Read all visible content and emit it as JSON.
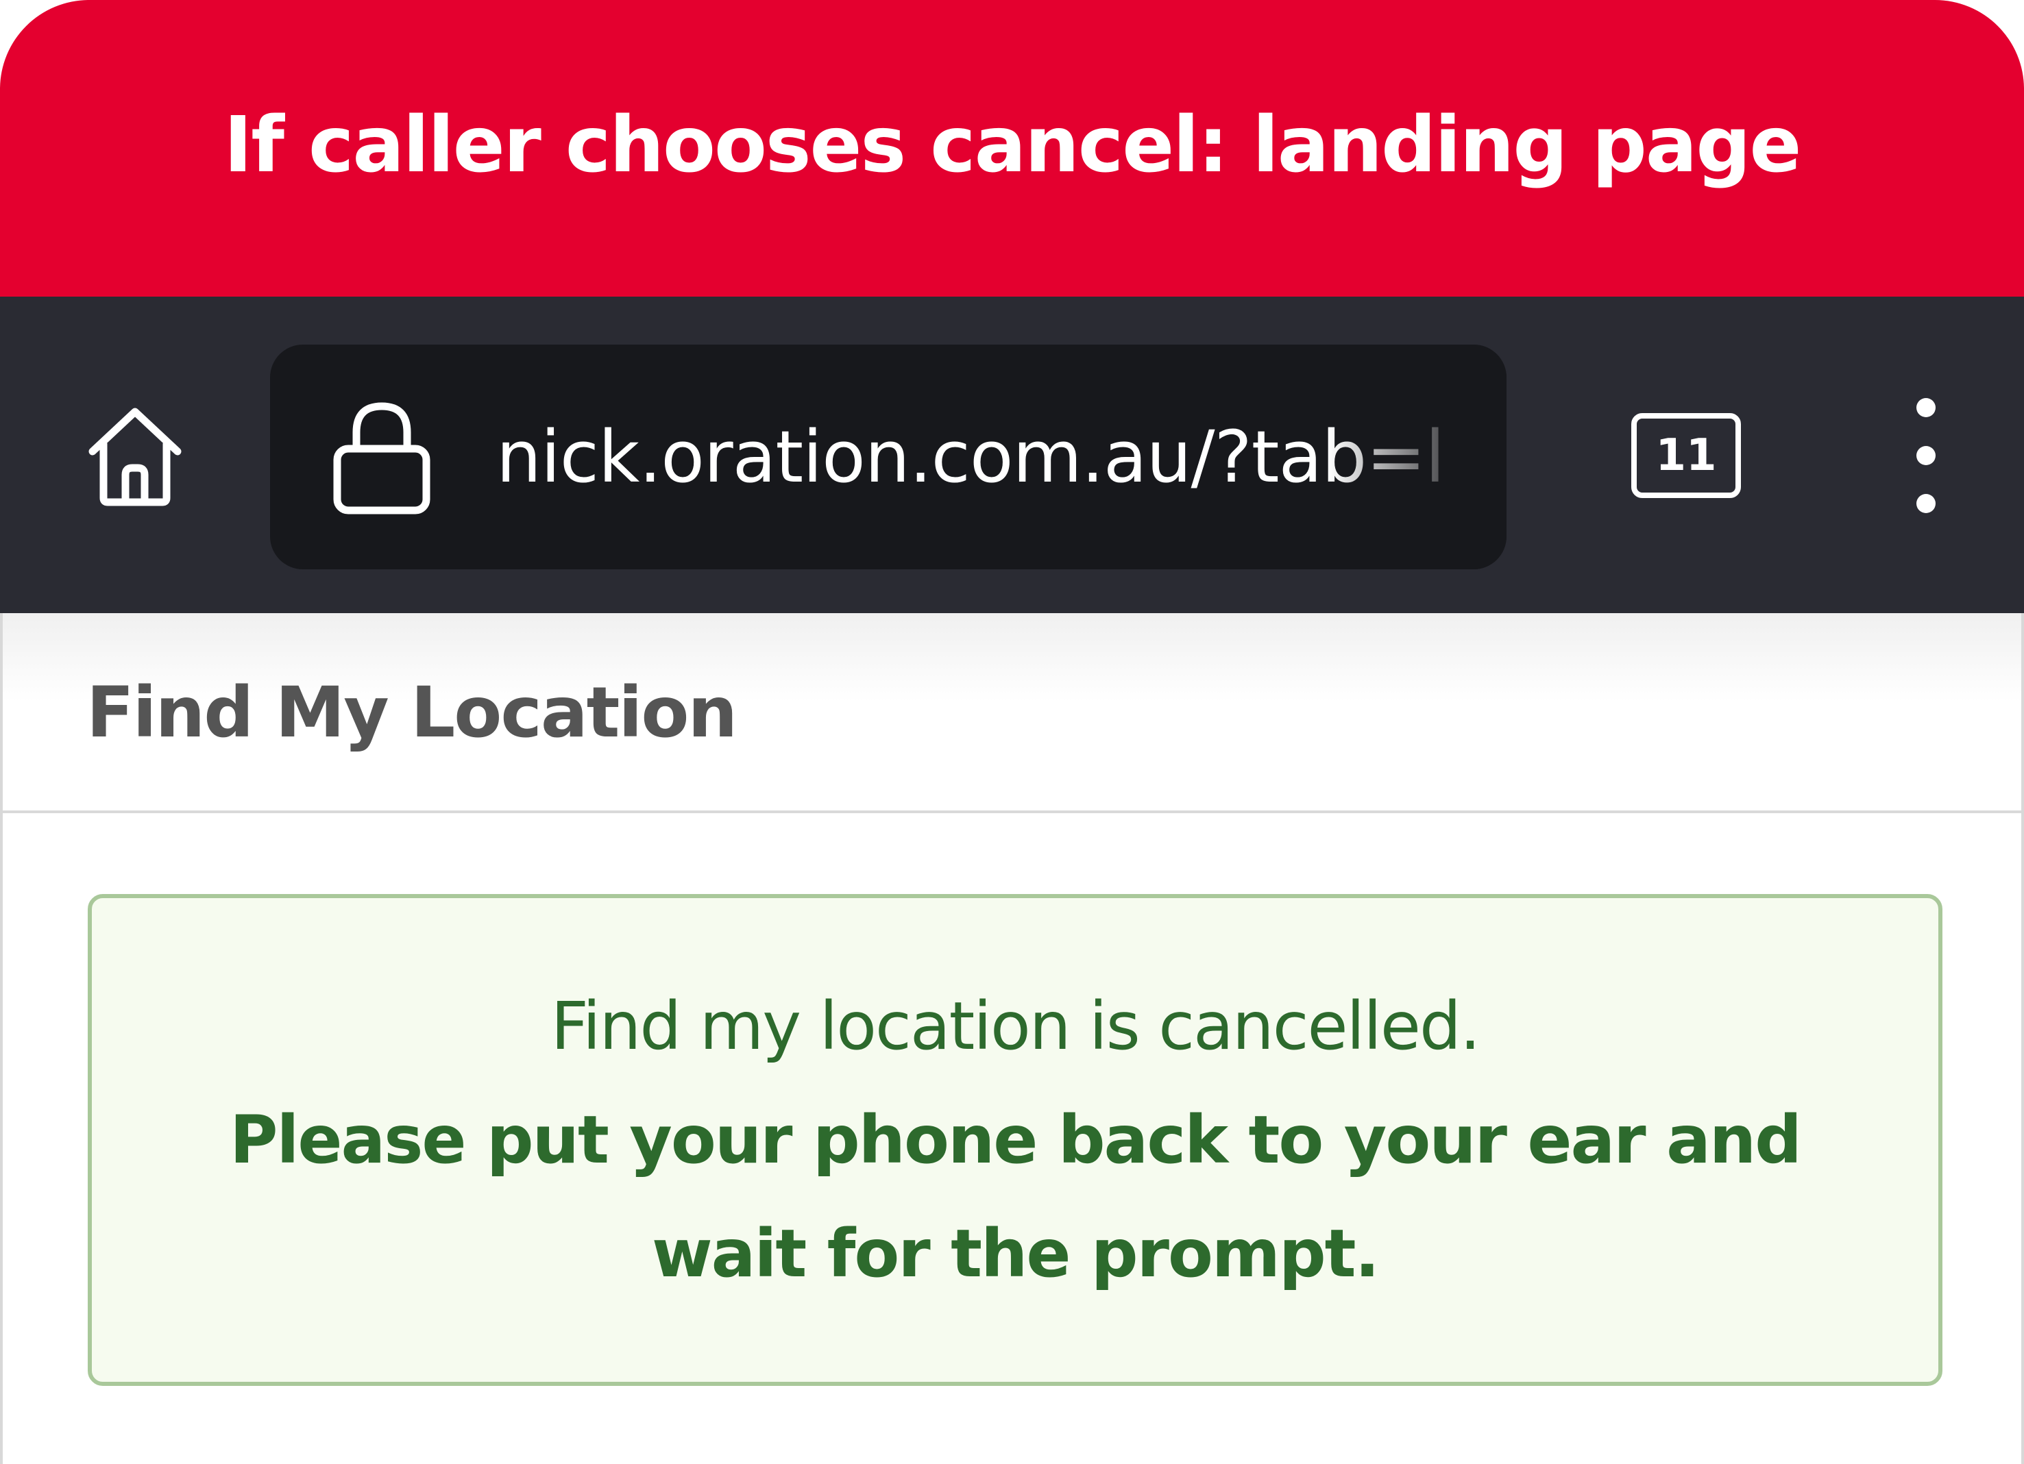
{
  "banner": {
    "title": "If caller chooses cancel: landing page",
    "color": "#e4002f"
  },
  "browser": {
    "home_icon": "home-icon",
    "lock_icon": "lock-icon",
    "url": "nick.oration.com.au/?tab=l",
    "tab_count": "11",
    "menu_icon": "more-vertical-icon"
  },
  "page": {
    "title": "Find My Location",
    "alert": {
      "line1": "Find my location is cancelled.",
      "line2": "Please put your phone back to your ear and wait for the prompt.",
      "text_color": "#2d6a2d",
      "background": "#f6fbef"
    }
  }
}
